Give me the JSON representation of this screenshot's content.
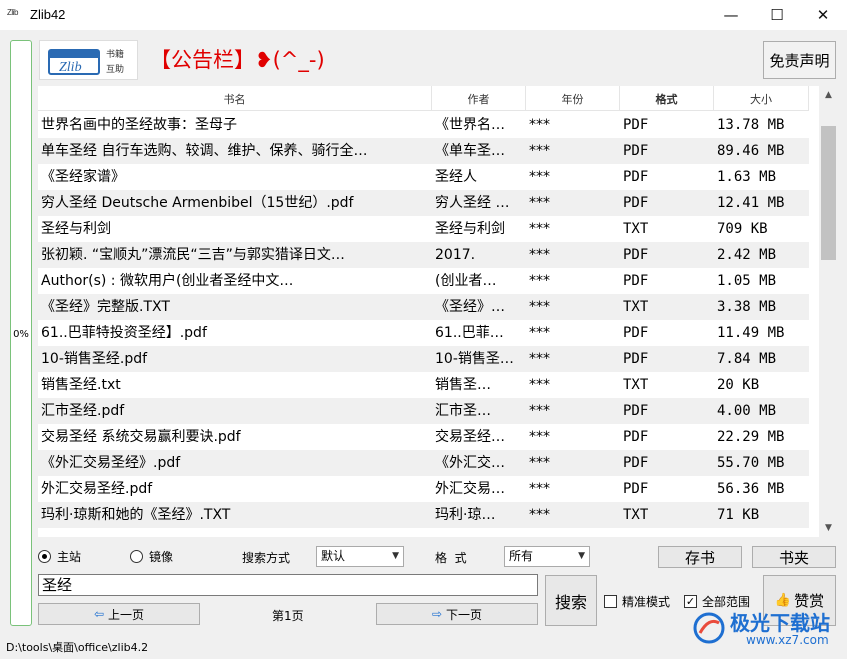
{
  "window": {
    "icon_text": "Zlib",
    "title": "Zlib42",
    "min_glyph": "—",
    "max_glyph": "☐",
    "close_glyph": "✕"
  },
  "progress": {
    "text": "0%",
    "value": 0
  },
  "logo": {
    "text": "Zlib",
    "cn_line1": "书籍",
    "cn_line2": "互助"
  },
  "notice": "【公告栏】❥(^_-)",
  "disclaimer_label": "免责声明",
  "table": {
    "headers": [
      "书名",
      "作者",
      "年份",
      "格式",
      "大小"
    ],
    "rows": [
      [
        "世界名画中的圣经故事：圣母子",
        "《世界名…",
        "***",
        "PDF",
        "13.78 MB"
      ],
      [
        "单车圣经 自行车选购、较调、维护、保养、骑行全…",
        "《单车圣…",
        "***",
        "PDF",
        "89.46 MB"
      ],
      [
        "《圣经家谱》",
        "圣经人",
        "***",
        "PDF",
        "1.63 MB"
      ],
      [
        "穷人圣经 Deutsche Armenbibel（15世纪）.pdf",
        "穷人圣经 …",
        "***",
        "PDF",
        "12.41 MB"
      ],
      [
        "圣经与利剑",
        "圣经与利剑",
        "***",
        "TXT",
        "709 KB"
      ],
      [
        "张初颖. “宝顺丸”漂流民“三吉”与郭实猎译日文…",
        "2017.",
        "***",
        "PDF",
        "2.42 MB"
      ],
      [
        "Author(s)       : 微软用户(创业者圣经中文…",
        "(创业者…",
        "***",
        "PDF",
        "1.05 MB"
      ],
      [
        "《圣经》完整版.TXT",
        "《圣经》…",
        "***",
        "TXT",
        "3.38 MB"
      ],
      [
        "61..巴菲特投资圣经】.pdf",
        "61..巴菲…",
        "***",
        "PDF",
        "11.49 MB"
      ],
      [
        "10-销售圣经.pdf",
        "10-销售圣…",
        "***",
        "PDF",
        "7.84 MB"
      ],
      [
        "销售圣经.txt",
        "销售圣…",
        "***",
        "TXT",
        "20 KB"
      ],
      [
        "汇市圣经.pdf",
        "汇市圣…",
        "***",
        "PDF",
        "4.00 MB"
      ],
      [
        "交易圣经  系统交易赢利要诀.pdf",
        "交易圣经…",
        "***",
        "PDF",
        "22.29 MB"
      ],
      [
        "《外汇交易圣经》.pdf",
        "《外汇交…",
        "***",
        "PDF",
        "55.70 MB"
      ],
      [
        "外汇交易圣经.pdf",
        "外汇交易…",
        "***",
        "PDF",
        "56.36 MB"
      ],
      [
        "玛利·琼斯和她的《圣经》.TXT",
        "玛利·琼…",
        "***",
        "TXT",
        "71 KB"
      ]
    ]
  },
  "source": {
    "main_label": "主站",
    "mirror_label": "镜像",
    "selected": "主站"
  },
  "search_mode": {
    "label": "搜索方式",
    "value": "默认"
  },
  "format_filter": {
    "label": "格  式",
    "value": "所有"
  },
  "buttons": {
    "save_books": "存书",
    "bookshelf": "书夹",
    "search": "搜索",
    "prev_page": "上一页",
    "next_page": "下一页",
    "like": "赞赏"
  },
  "search_query": "圣经",
  "page_label": "第1页",
  "options": {
    "exact_mode": "精准模式",
    "exact_checked": false,
    "full_range": "全部范围",
    "full_checked": true
  },
  "status_path": "D:\\tools\\桌面\\office\\zlib4.2",
  "watermark": {
    "text": "极光下载站",
    "url": "www.xz7.com"
  },
  "colors": {
    "notice": "#e00000",
    "progress_border": "#7ac27a",
    "accent_blue": "#1e6fd1",
    "row_alt": "#f0f0f0"
  }
}
